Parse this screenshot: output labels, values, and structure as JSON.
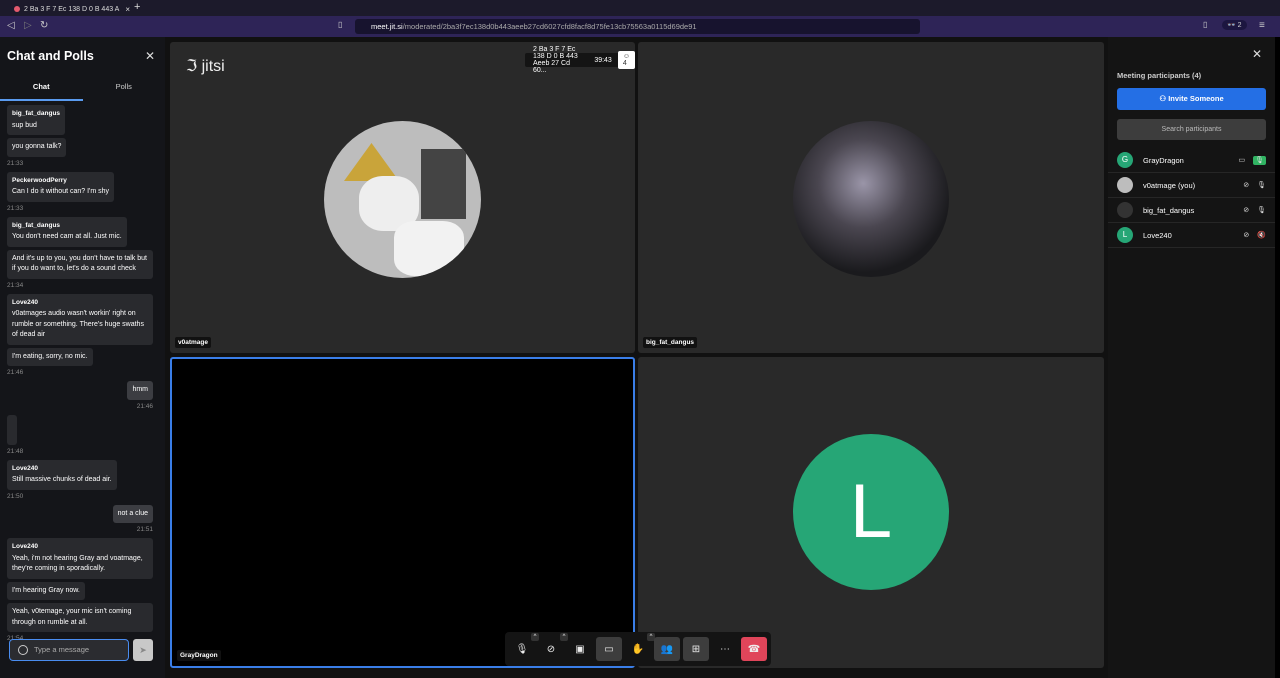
{
  "browser": {
    "tab_title": "2 Ba 3 F 7 Ec 138 D 0 B 443 A",
    "url_domain": "meet.jit.si",
    "url_path": "/moderated/2ba3f7ec138d0b443aeeb27cd6027cfd8facf8d75fe13cb75563a0115d69de91",
    "profile_count": "2"
  },
  "chat": {
    "title": "Chat and Polls",
    "tabs": [
      "Chat",
      "Polls"
    ],
    "placeholder": "Type a message",
    "messages": [
      {
        "who": "big_fat_dangus",
        "text": "sup bud"
      },
      {
        "text": "you gonna talk?",
        "ts": "21:33"
      },
      {
        "who": "PeckerwoodPerry",
        "text": "Can I do it without can? I'm shy",
        "ts": "21:33"
      },
      {
        "who": "big_fat_dangus",
        "text": "You don't need cam at all. Just mic."
      },
      {
        "text": "And it's up to you, you don't have to talk but if you do want to, let's do a sound check",
        "ts": "21:34"
      },
      {
        "who": "Love240",
        "text": "v0atmages audio wasn't workin' right on rumble or something. There's huge swaths of dead air"
      },
      {
        "text": "I'm eating, sorry, no mic.",
        "ts": "21:46"
      },
      {
        "text": "hmm",
        "ts": "21:46",
        "me": true
      },
      {
        "text": "",
        "ts": "21:48"
      },
      {
        "who": "Love240",
        "text": "Still massive chunks of dead air.",
        "ts": "21:50"
      },
      {
        "text": "not a clue",
        "ts": "21:51",
        "me": true
      },
      {
        "who": "Love240",
        "text": "Yeah, i'm not hearing Gray and voatmage, they're coming in sporadically."
      },
      {
        "text": "I'm hearing Gray now."
      },
      {
        "text": "Yeah, v0temage, your mic isn't coming through on rumble at all.",
        "ts": "21:54"
      }
    ]
  },
  "stage": {
    "logo": "jitsi",
    "meeting_name": "2 Ba 3 F 7 Ec 138 D 0 B 443 Aeeb 27 Cd 60...",
    "timer": "39:43",
    "participant_count": "4",
    "tiles": [
      "v0atmage",
      "big_fat_dangus",
      "GrayDragon",
      ""
    ],
    "love_initial": "L"
  },
  "participants": {
    "title": "Meeting participants (4)",
    "invite": "Invite Someone",
    "search": "Search participants",
    "list": [
      {
        "name": "GrayDragon",
        "initial": "G"
      },
      {
        "name": "v0atmage (you)"
      },
      {
        "name": "big_fat_dangus"
      },
      {
        "name": "Love240",
        "initial": "L"
      }
    ]
  },
  "colors": {
    "accent": "#246fe5",
    "hangup": "#e0455a",
    "avatar_green": "#26a676"
  }
}
